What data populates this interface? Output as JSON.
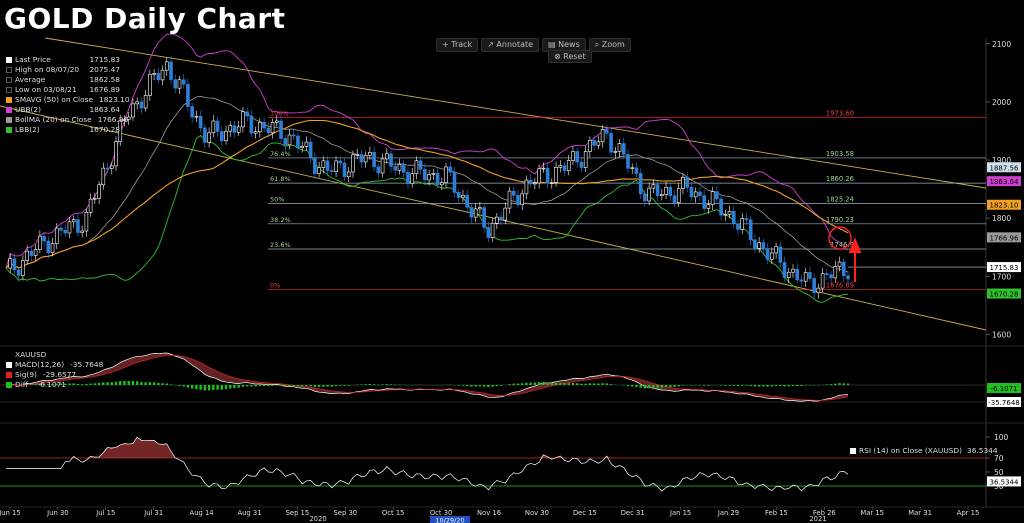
{
  "header": {
    "title": "GOLD Daily Chart"
  },
  "toolbar": {
    "track": "+ Track",
    "annotate": "↗ Annotate",
    "news": "▤ News",
    "zoom": "⌕ Zoom",
    "reset": "⊗ Reset"
  },
  "legend_main": [
    {
      "label": "Last Price",
      "value": "1715.83",
      "color": "#ffffff"
    },
    {
      "label": "High on 08/07/20",
      "value": "2075.47",
      "color": "#000000"
    },
    {
      "label": "Average",
      "value": "1862.58",
      "color": "#000000"
    },
    {
      "label": "Low on 03/08/21",
      "value": "1676.89",
      "color": "#000000"
    },
    {
      "label": "SMAVG (50)  on Close",
      "value": "1823.10",
      "color": "#f0a020"
    },
    {
      "label": "UBB(2)",
      "value": "1863.64",
      "color": "#d040d0"
    },
    {
      "label": "BollMA (20)  on Close",
      "value": "1766.96",
      "color": "#9a9a9a"
    },
    {
      "label": "LBB(2)",
      "value": "1670.28",
      "color": "#30c030"
    }
  ],
  "legend_macd": [
    {
      "label": "XAUUSD",
      "value": "",
      "color": ""
    },
    {
      "label": "MACD(12,26)",
      "value": "-35.7648",
      "color": "#ffffff"
    },
    {
      "label": "Sig(9)",
      "value": "-29.6577",
      "color": "#e02020"
    },
    {
      "label": "Diff",
      "value": "-6.1071",
      "color": "#20c020"
    }
  ],
  "legend_rsi": {
    "label": "RSI (14)  on Close (XAUUSD)",
    "value": "36.5344"
  },
  "chart_data": {
    "type": "line",
    "title": "GOLD Daily Chart",
    "price_ticks": [
      1600,
      1700,
      1800,
      1900,
      2000,
      2100
    ],
    "price_ylim": [
      1580,
      2110
    ],
    "xlabels": [
      "Jun 15",
      "Jun 30",
      "Jul 15",
      "Jul 31",
      "Aug 14",
      "Aug 31",
      "Sep 15",
      "Sep 30",
      "Oct 15",
      "Oct 30",
      "Nov 16",
      "Nov 30",
      "Dec 15",
      "Dec 31",
      "Jan 15",
      "Jan 29",
      "Feb 15",
      "Feb 26",
      "Mar 15",
      "Mar 31",
      "Apr 15"
    ],
    "year_labels": [
      "2020",
      "2021"
    ],
    "cursor_date": "10/29/20",
    "price_series": {
      "dates": [
        "Jun 15",
        "Jun 30",
        "Jul 15",
        "Jul 31",
        "Aug 07",
        "Aug 14",
        "Aug 31",
        "Sep 15",
        "Sep 30",
        "Oct 15",
        "Oct 30",
        "Nov 16",
        "Nov 30",
        "Dec 15",
        "Dec 31",
        "Jan 06",
        "Jan 15",
        "Jan 29",
        "Feb 15",
        "Feb 26",
        "Mar 08",
        "Mar 10"
      ],
      "values": [
        1705,
        1760,
        1800,
        1975,
        2065,
        1940,
        1965,
        1945,
        1880,
        1905,
        1880,
        1870,
        1780,
        1860,
        1890,
        1945,
        1840,
        1850,
        1810,
        1740,
        1685,
        1716
      ]
    },
    "fibonacci": [
      {
        "label": "100%",
        "value": 1973.6
      },
      {
        "label": "76.4%",
        "value": 1903.58
      },
      {
        "label": "61.8%",
        "value": 1860.26
      },
      {
        "label": "50%",
        "value": 1825.24
      },
      {
        "label": "38.2%",
        "value": 1790.23
      },
      {
        "label": "23.6%",
        "value": 1746.9
      },
      {
        "label": "0%",
        "value": 1676.89
      }
    ],
    "fib_value_labels": [
      "1973.60",
      "1903.58",
      "1860.26",
      "1825.24",
      "1790.23",
      "1746.9",
      "1676.89"
    ],
    "price_tags": [
      {
        "text": "1887.56",
        "value": 1887.56,
        "color": "#cfe0ee",
        "text_color": "#000"
      },
      {
        "text": "1863.64",
        "value": 1863.64,
        "color": "#d040d0",
        "text_color": "#000"
      },
      {
        "text": "1823.10",
        "value": 1823.1,
        "color": "#f0a020",
        "text_color": "#000"
      },
      {
        "text": "1766.96",
        "value": 1766.96,
        "color": "#9a9a9a",
        "text_color": "#000"
      },
      {
        "text": "1715.83",
        "value": 1715.83,
        "color": "#ffffff",
        "text_color": "#000"
      },
      {
        "text": "1670.28",
        "value": 1670.28,
        "color": "#30c030",
        "text_color": "#000"
      }
    ],
    "macd_tags": [
      {
        "text": "-6.1071",
        "color": "#20c020",
        "text_color": "#000"
      },
      {
        "text": "-35.7648",
        "color": "#ffffff",
        "text_color": "#000"
      }
    ],
    "rsi_ticks": [
      30,
      50,
      70,
      100
    ],
    "rsi_ylim": [
      0,
      100
    ],
    "rsi_tag": {
      "text": "36.5344",
      "color": "#ffffff",
      "text_color": "#000"
    },
    "colors": {
      "up": "#ffffff",
      "down": "#2d7fd8",
      "channel": "#c9b14a",
      "fib_top": "#e03030",
      "fib_mid": "#9ab0bf",
      "sma50": "#f0a020",
      "ubb": "#d040d0",
      "bollma": "#9a9a9a",
      "lbb": "#30c030",
      "annotation": "#ff2020"
    }
  }
}
